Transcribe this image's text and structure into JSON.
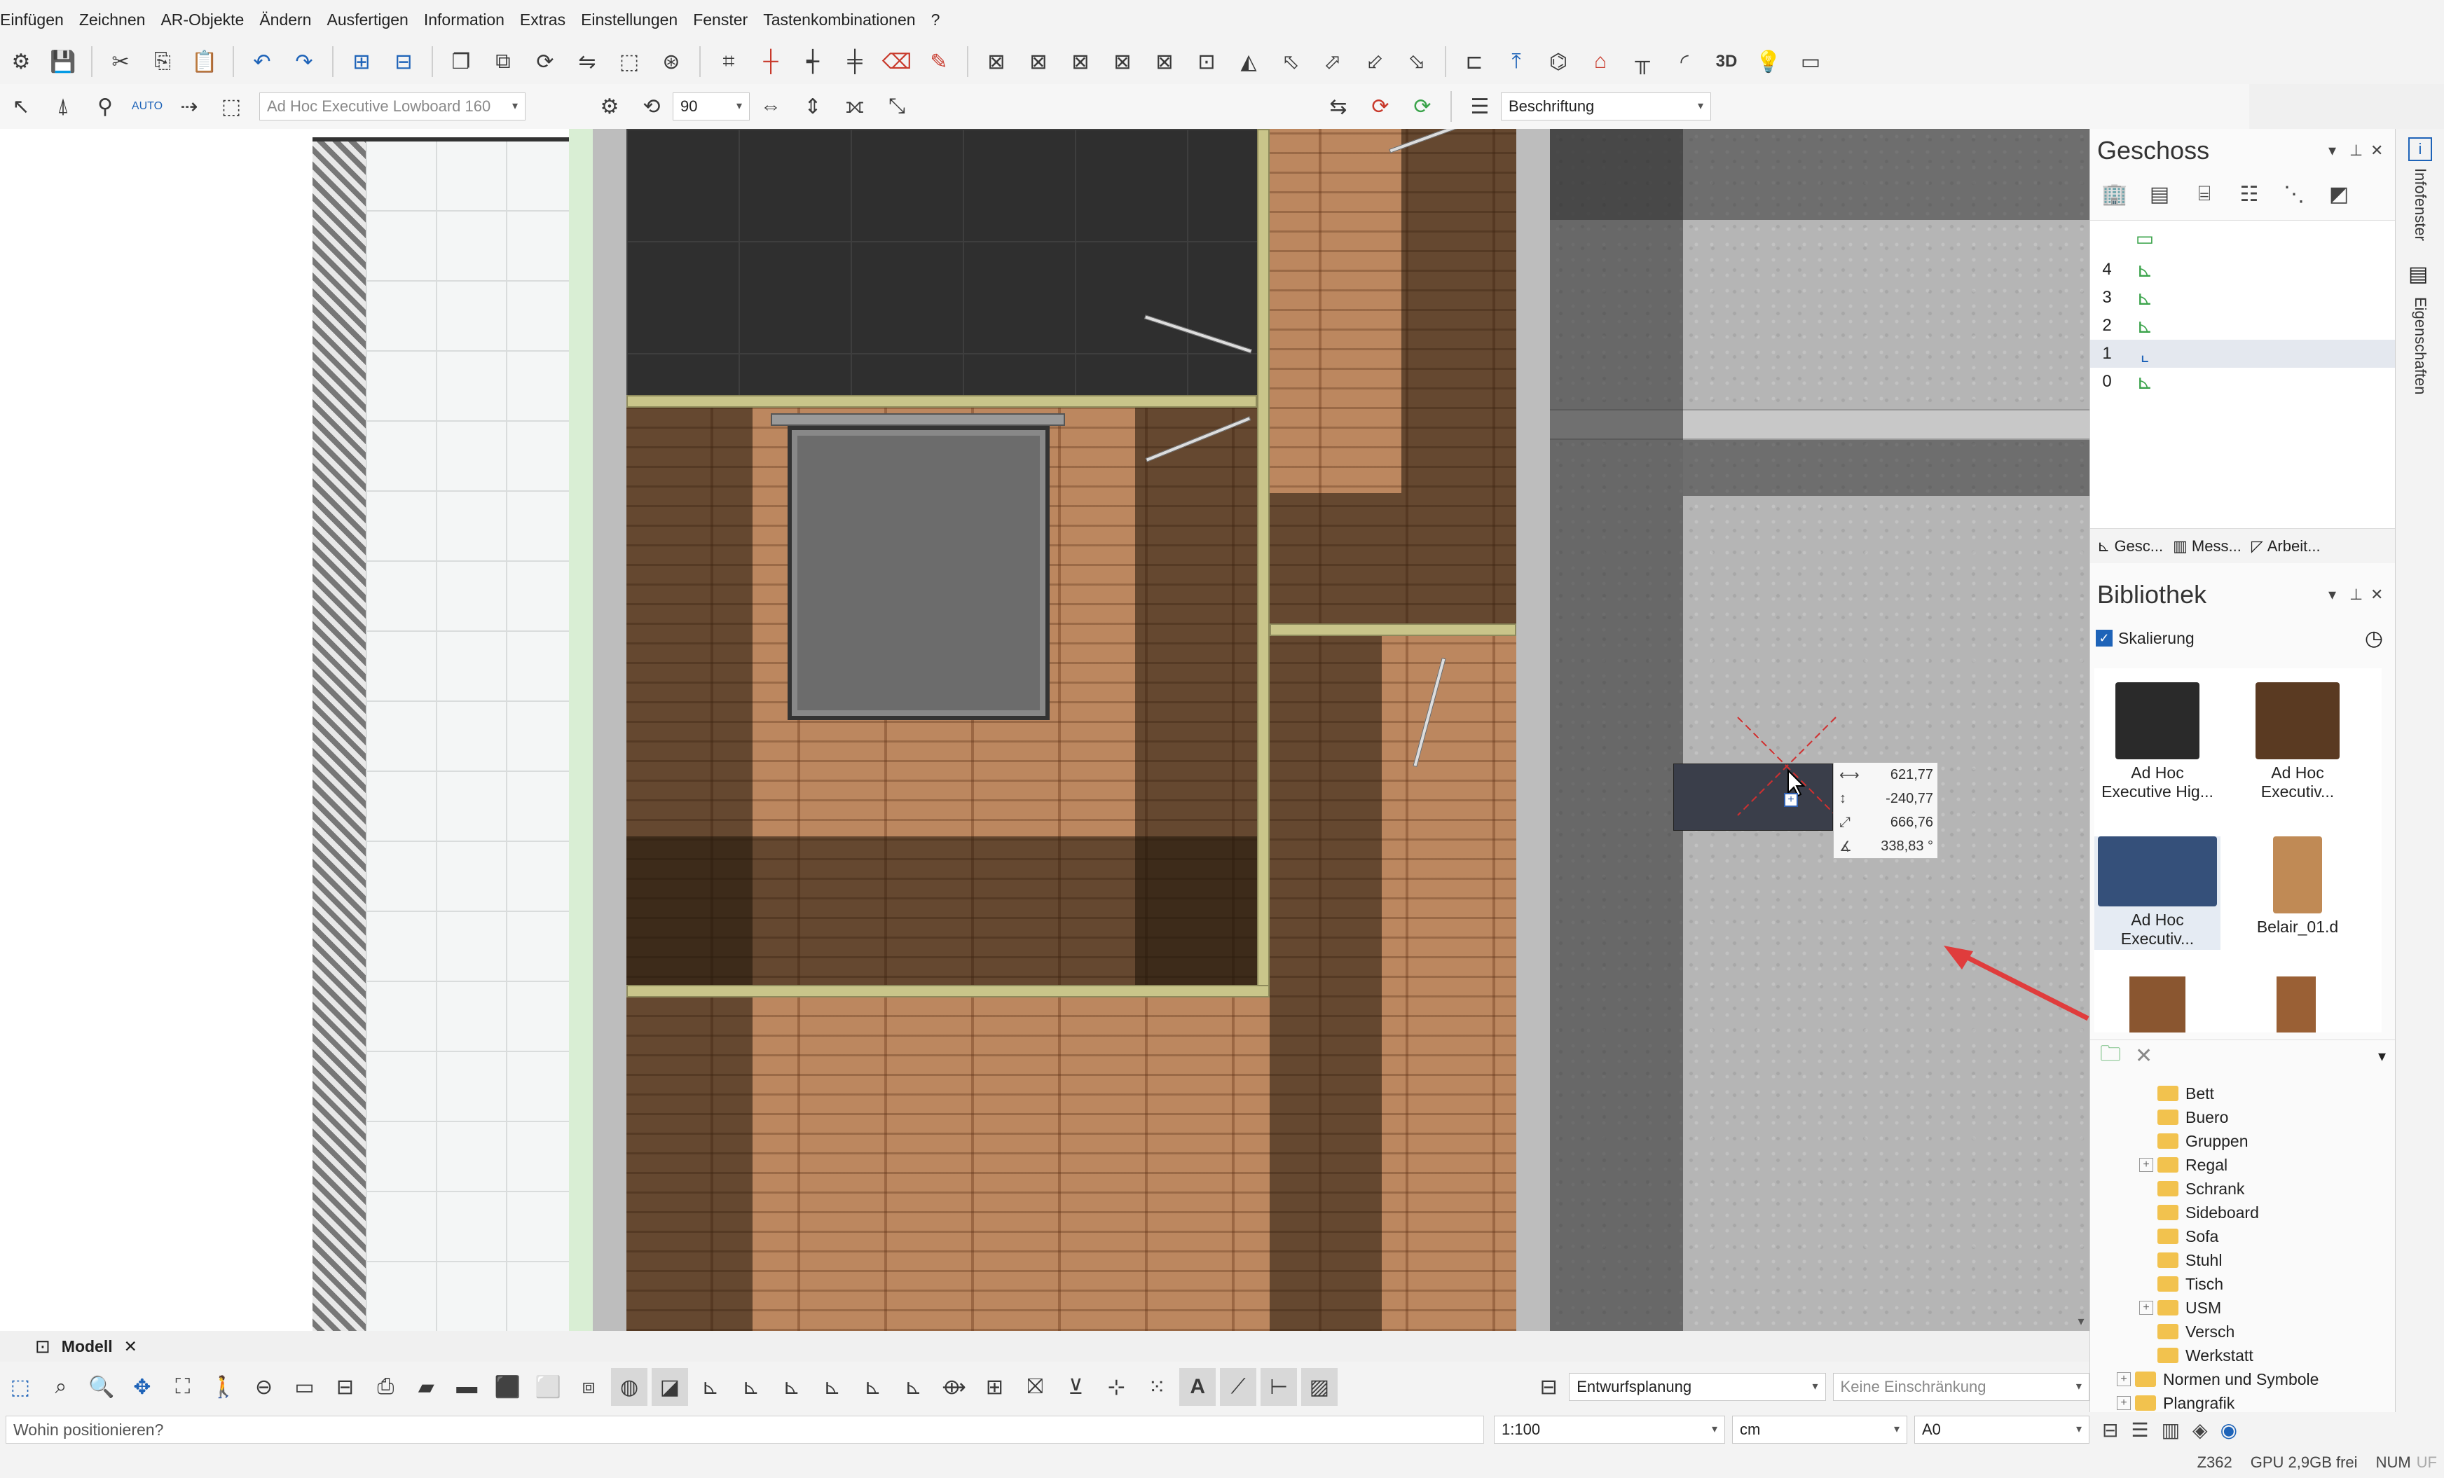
{
  "menu": [
    "Einfügen",
    "Zeichnen",
    "AR-Objekte",
    "Ändern",
    "Ausfertigen",
    "Information",
    "Extras",
    "Einstellungen",
    "Fenster",
    "Tastenkombinationen",
    "?"
  ],
  "toolbar2": {
    "object_combo": "Ad Hoc Executive Lowboard 160",
    "angle_value": "90",
    "layer_combo": "Beschriftung"
  },
  "dimension_tooltip": {
    "dx": "621,77",
    "dy": "-240,77",
    "distance": "666,76",
    "angle": "338,83 °"
  },
  "geschoss_panel": {
    "title": "Geschoss",
    "floors": [
      {
        "num": "4",
        "active": false
      },
      {
        "num": "3",
        "active": false
      },
      {
        "num": "2",
        "active": false
      },
      {
        "num": "1",
        "active": true
      },
      {
        "num": "0",
        "active": false
      }
    ],
    "tabs": [
      "Gesc...",
      "Mess...",
      "Arbeit..."
    ]
  },
  "bibliothek_panel": {
    "title": "Bibliothek",
    "checkbox_label": "Skalierung",
    "items": [
      {
        "label": "Ad Hoc Executive Hig...",
        "color": "#2a2a2a"
      },
      {
        "label": "Ad Hoc Executiv...",
        "color": "#5a3a22"
      },
      {
        "label": "Ad Hoc Executiv...",
        "color": "#35507a"
      },
      {
        "label": "Belair_01.d",
        "color": "#c08a55"
      }
    ],
    "tree": [
      {
        "label": "Bett",
        "plus": false,
        "indent": 1
      },
      {
        "label": "Buero",
        "plus": false,
        "indent": 1
      },
      {
        "label": "Gruppen",
        "plus": false,
        "indent": 1
      },
      {
        "label": "Regal",
        "plus": true,
        "indent": 1
      },
      {
        "label": "Schrank",
        "plus": false,
        "indent": 1
      },
      {
        "label": "Sideboard",
        "plus": false,
        "indent": 1
      },
      {
        "label": "Sofa",
        "plus": false,
        "indent": 1
      },
      {
        "label": "Stuhl",
        "plus": false,
        "indent": 1
      },
      {
        "label": "Tisch",
        "plus": false,
        "indent": 1
      },
      {
        "label": "USM",
        "plus": true,
        "indent": 1
      },
      {
        "label": "Versch",
        "plus": false,
        "indent": 1
      },
      {
        "label": "Werkstatt",
        "plus": false,
        "indent": 1
      },
      {
        "label": "Normen und Symbole",
        "plus": true,
        "indent": 0
      },
      {
        "label": "Plangrafik",
        "plus": true,
        "indent": 0
      }
    ]
  },
  "side_strip": [
    "Infofenster",
    "Eigenschaften"
  ],
  "model_tab": "Modell",
  "bottom": {
    "planning_combo": "Entwurfsplanung",
    "restriction_combo": "Keine Einschränkung",
    "prompt": "Wohin positionieren?",
    "scale": "1:100",
    "unit": "cm",
    "paper": "A0"
  },
  "info": {
    "zoom": "Z362",
    "gpu": "GPU 2,9GB frei",
    "num": "NUM",
    "uf": "UF"
  },
  "colors": {
    "accent": "#1e63b8",
    "arrow": "#e03c3c"
  }
}
